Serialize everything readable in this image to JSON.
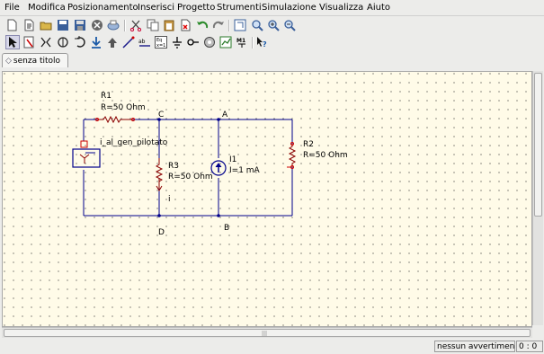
{
  "menu": [
    "File",
    "Modifica",
    "Posizionamento",
    "Inserisci",
    "Progetto",
    "Strumenti",
    "Simulazione",
    "Visualizza",
    "Aiuto"
  ],
  "toolbar1_icons": [
    "new-document-icon",
    "new-text-icon",
    "open-icon",
    "save-icon",
    "save-all-icon",
    "close-icon",
    "print-icon",
    "cut-icon",
    "copy-icon",
    "paste-icon",
    "delete-icon",
    "undo-icon",
    "redo-icon",
    "zoom-page-icon",
    "zoom-fit-icon",
    "zoom-in-icon",
    "zoom-out-icon"
  ],
  "toolbar2_icons": [
    "select-arrow-icon",
    "edit-component-icon",
    "mirror-x-icon",
    "mirror-y-icon",
    "rotate-icon",
    "activate-icon",
    "move-up-icon",
    "wire-icon",
    "wire-label-icon",
    "insert-equation-icon",
    "ground-icon",
    "port-icon",
    "simulate-icon",
    "view-data-icon",
    "marker-icon",
    "help-icon"
  ],
  "tab": {
    "label": "senza titolo",
    "icon": "document-tab-icon"
  },
  "schematic": {
    "r1": {
      "name": "R1",
      "value": "R=50 Ohm"
    },
    "r2": {
      "name": "R2",
      "value": "R=50 Ohm"
    },
    "r3": {
      "name": "R3",
      "value": "R=50 Ohm"
    },
    "i1": {
      "name": "I1",
      "value": "I=1 mA"
    },
    "controlled_source": {
      "label": "i_al_gen_pilotato"
    },
    "nodes": {
      "a": "A",
      "b": "B",
      "c": "C",
      "d": "D"
    },
    "current_label": "i"
  },
  "status": {
    "message": "nessun avvertimento",
    "position": "0 : 0"
  },
  "colors": {
    "wire": "#00008b",
    "component": "#8b0000",
    "canvas": "#fffbe8"
  }
}
